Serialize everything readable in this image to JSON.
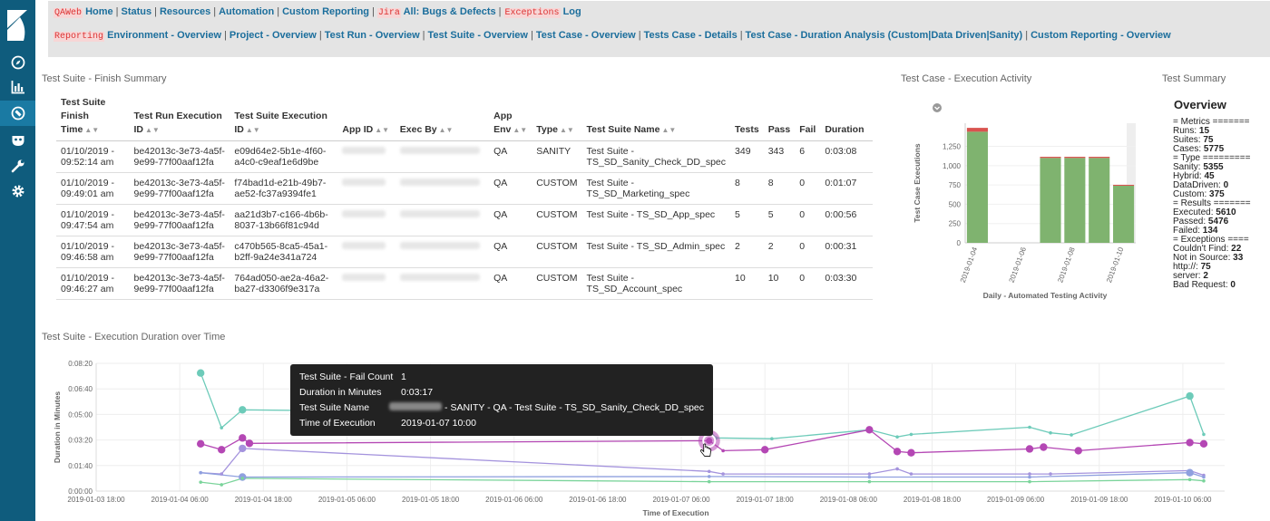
{
  "nav": {
    "row1": [
      {
        "tag": "QAWeb",
        "label": "Home"
      },
      {
        "tag": "",
        "label": "Status"
      },
      {
        "tag": "",
        "label": "Resources"
      },
      {
        "tag": "",
        "label": "Automation"
      },
      {
        "tag": "",
        "label": "Custom Reporting"
      },
      {
        "tag": "Jira",
        "label": "All: Bugs & Defects"
      },
      {
        "tag": "Exceptions",
        "label": "Log"
      }
    ],
    "row2": [
      {
        "tag": "Reporting",
        "label": "Environment - Overview"
      },
      {
        "tag": "",
        "label": "Project - Overview"
      },
      {
        "tag": "",
        "label": "Test Run - Overview"
      },
      {
        "tag": "",
        "label": "Test Suite - Overview"
      },
      {
        "tag": "",
        "label": "Test Case - Overview"
      },
      {
        "tag": "",
        "label": "Tests Case - Details"
      },
      {
        "tag": "",
        "label": "Test Case - Duration Analysis (Custom|Data Driven|Sanity)"
      },
      {
        "tag": "",
        "label": "Custom Reporting - Overview"
      }
    ]
  },
  "panels": {
    "finish_summary": "Test Suite - Finish Summary",
    "execution_activity": "Test Case - Execution Activity",
    "test_summary": "Test Summary",
    "duration_over_time": "Test Suite - Execution Duration over Time"
  },
  "table": {
    "headers": [
      "Test Suite Finish Time",
      "Test Run Execution ID",
      "Test Suite Execution ID",
      "App ID",
      "Exec By",
      "App Env",
      "Type",
      "Test Suite Name",
      "Tests",
      "Pass",
      "Fail",
      "Duration"
    ],
    "rows": [
      {
        "finish": "01/10/2019 - 09:52:14 am",
        "run_id": "be42013c-3e73-4a5f-9e99-77f00aaf12fa",
        "suite_id": "e09d64e2-5b1e-4f60-a4c0-c9eaf1e6d9be",
        "env": "QA",
        "type": "SANITY",
        "name": "Test Suite - TS_SD_Sanity_Check_DD_spec",
        "tests": "349",
        "pass": "343",
        "fail": "6",
        "duration": "0:03:08"
      },
      {
        "finish": "01/10/2019 - 09:49:01 am",
        "run_id": "be42013c-3e73-4a5f-9e99-77f00aaf12fa",
        "suite_id": "f74bad1d-e21b-49b7-ae52-fc37a9394fe1",
        "env": "QA",
        "type": "CUSTOM",
        "name": "Test Suite - TS_SD_Marketing_spec",
        "tests": "8",
        "pass": "8",
        "fail": "0",
        "duration": "0:01:07"
      },
      {
        "finish": "01/10/2019 - 09:47:54 am",
        "run_id": "be42013c-3e73-4a5f-9e99-77f00aaf12fa",
        "suite_id": "aa21d3b7-c166-4b6b-8037-13b66f81c94d",
        "env": "QA",
        "type": "CUSTOM",
        "name": "Test Suite - TS_SD_App_spec",
        "tests": "5",
        "pass": "5",
        "fail": "0",
        "duration": "0:00:56"
      },
      {
        "finish": "01/10/2019 - 09:46:58 am",
        "run_id": "be42013c-3e73-4a5f-9e99-77f00aaf12fa",
        "suite_id": "c470b565-8ca5-45a1-b2ff-9a24e341a724",
        "env": "QA",
        "type": "CUSTOM",
        "name": "Test Suite - TS_SD_Admin_spec",
        "tests": "2",
        "pass": "2",
        "fail": "0",
        "duration": "0:00:31"
      },
      {
        "finish": "01/10/2019 - 09:46:27 am",
        "run_id": "be42013c-3e73-4a5f-9e99-77f00aaf12fa",
        "suite_id": "764ad050-ae2a-46a2-ba27-d3306f9e317a",
        "env": "QA",
        "type": "CUSTOM",
        "name": "Test Suite - TS_SD_Account_spec",
        "tests": "10",
        "pass": "10",
        "fail": "0",
        "duration": "0:03:30"
      }
    ]
  },
  "summary": {
    "title": "Overview",
    "lines": [
      {
        "k": "= Metrics =======",
        "v": "",
        "head": true
      },
      {
        "k": "Runs: ",
        "v": "15"
      },
      {
        "k": "Suites: ",
        "v": "75"
      },
      {
        "k": "Cases: ",
        "v": "5775"
      },
      {
        "k": "= Type =========",
        "v": "",
        "head": true
      },
      {
        "k": "Sanity: ",
        "v": "5355"
      },
      {
        "k": "Hybrid: ",
        "v": "45"
      },
      {
        "k": "DataDriven: ",
        "v": "0"
      },
      {
        "k": "Custom: ",
        "v": "375"
      },
      {
        "k": "= Results =======",
        "v": "",
        "head": true
      },
      {
        "k": "Executed: ",
        "v": "5610"
      },
      {
        "k": "Passed: ",
        "v": "5476"
      },
      {
        "k": "Failed: ",
        "v": "134"
      },
      {
        "k": "= Exceptions ====",
        "v": "",
        "head": true
      },
      {
        "k": "Couldn't Find: ",
        "v": "22"
      },
      {
        "k": "Not in Source: ",
        "v": "33"
      },
      {
        "k": "http://: ",
        "v": "75"
      },
      {
        "k": "server: ",
        "v": "2"
      },
      {
        "k": "Bad Request: ",
        "v": "0"
      }
    ]
  },
  "tooltip": {
    "rows": [
      {
        "k": "Test Suite - Fail Count",
        "v": "1"
      },
      {
        "k": "Duration in Minutes",
        "v": "0:03:17"
      },
      {
        "k": "Test Suite Name",
        "v": " - SANITY - QA - Test Suite - TS_SD_Sanity_Check_DD_spec"
      },
      {
        "k": "Time of Execution",
        "v": "2019-01-07 10:00"
      }
    ]
  },
  "chart_data": [
    {
      "type": "bar",
      "xlabel": "Daily - Automated Testing Activity",
      "ylabel": "Test Case Executions",
      "categories": [
        "2019-01-04",
        "2019-01-05",
        "2019-01-06",
        "2019-01-07",
        "2019-01-08",
        "2019-01-09",
        "2019-01-10"
      ],
      "tick_labels": [
        "2019-01-04",
        "2019-01-06",
        "2019-01-08",
        "2019-01-10"
      ],
      "yticks": [
        0,
        250,
        500,
        750,
        1000,
        1250
      ],
      "ylim": [
        0,
        1550
      ],
      "series": [
        {
          "color": "#7fb36f",
          "values": [
            1440,
            0,
            0,
            1100,
            1100,
            1100,
            740
          ]
        },
        {
          "color": "#d9534f",
          "values": [
            50,
            0,
            0,
            15,
            15,
            15,
            12
          ]
        }
      ]
    },
    {
      "type": "line",
      "xlabel": "Time of Execution",
      "ylabel": "Duration in Minutes",
      "xlim": [
        "2019-01-03 18:00",
        "2019-01-10 12:00"
      ],
      "xticks": [
        "2019-01-03 18:00",
        "2019-01-04 06:00",
        "2019-01-04 18:00",
        "2019-01-05 06:00",
        "2019-01-05 18:00",
        "2019-01-06 06:00",
        "2019-01-06 18:00",
        "2019-01-07 06:00",
        "2019-01-07 18:00",
        "2019-01-08 06:00",
        "2019-01-08 18:00",
        "2019-01-09 06:00",
        "2019-01-09 18:00",
        "2019-01-10 06:00"
      ],
      "yticks": [
        "0:00:00",
        "0:01:40",
        "0:03:20",
        "0:05:00",
        "0:06:40",
        "0:08:20"
      ],
      "ylim": [
        0,
        500
      ],
      "series": [
        {
          "color": "#6dcbb9",
          "points": [
            [
              "2019-01-04 09:00",
              462
            ],
            [
              "2019-01-04 12:00",
              248
            ],
            [
              "2019-01-04 15:00",
              318
            ],
            [
              "2019-01-07 08:00",
              300
            ],
            [
              "2019-01-07 11:00",
              208
            ],
            [
              "2019-01-07 19:00",
              205
            ],
            [
              "2019-01-08 09:00",
              240
            ],
            [
              "2019-01-08 13:00",
              212
            ],
            [
              "2019-01-08 15:00",
              222
            ],
            [
              "2019-01-09 08:00",
              250
            ],
            [
              "2019-01-09 11:00",
              228
            ],
            [
              "2019-01-09 14:00",
              220
            ],
            [
              "2019-01-10 07:00",
              372
            ],
            [
              "2019-01-10 09:00",
              222
            ]
          ]
        },
        {
          "color": "#b447b4",
          "points": [
            [
              "2019-01-04 09:00",
              185
            ],
            [
              "2019-01-04 12:00",
              162
            ],
            [
              "2019-01-04 15:00",
              208
            ],
            [
              "2019-01-04 16:00",
              187
            ],
            [
              "2019-01-07 10:00",
              197
            ],
            [
              "2019-01-07 12:00",
              158
            ],
            [
              "2019-01-07 18:00",
              162
            ],
            [
              "2019-01-08 09:00",
              240
            ],
            [
              "2019-01-08 13:00",
              155
            ],
            [
              "2019-01-08 15:00",
              150
            ],
            [
              "2019-01-09 08:00",
              165
            ],
            [
              "2019-01-09 10:00",
              172
            ],
            [
              "2019-01-09 15:00",
              158
            ],
            [
              "2019-01-10 07:00",
              190
            ],
            [
              "2019-01-10 09:00",
              185
            ]
          ]
        },
        {
          "color": "#a493dd",
          "points": [
            [
              "2019-01-04 09:00",
              72
            ],
            [
              "2019-01-04 12:00",
              67
            ],
            [
              "2019-01-04 15:00",
              167
            ],
            [
              "2019-01-07 10:00",
              77
            ],
            [
              "2019-01-07 12:00",
              67
            ],
            [
              "2019-01-08 09:00",
              67
            ],
            [
              "2019-01-08 13:00",
              87
            ],
            [
              "2019-01-08 15:00",
              67
            ],
            [
              "2019-01-09 08:00",
              67
            ],
            [
              "2019-01-09 11:00",
              67
            ],
            [
              "2019-01-10 07:00",
              80
            ],
            [
              "2019-01-10 09:00",
              62
            ]
          ]
        },
        {
          "color": "#8fa0df",
          "points": [
            [
              "2019-01-04 09:00",
              72
            ],
            [
              "2019-01-04 15:00",
              55
            ],
            [
              "2019-01-07 10:00",
              57
            ],
            [
              "2019-01-08 09:00",
              55
            ],
            [
              "2019-01-09 08:00",
              55
            ],
            [
              "2019-01-10 07:00",
              72
            ],
            [
              "2019-01-10 09:00",
              55
            ]
          ]
        },
        {
          "color": "#7bd49b",
          "points": [
            [
              "2019-01-04 09:00",
              35
            ],
            [
              "2019-01-04 12:00",
              25
            ],
            [
              "2019-01-04 15:00",
              50
            ],
            [
              "2019-01-07 10:00",
              37
            ],
            [
              "2019-01-08 09:00",
              37
            ],
            [
              "2019-01-09 08:00",
              37
            ],
            [
              "2019-01-10 07:00",
              45
            ],
            [
              "2019-01-10 09:00",
              40
            ]
          ]
        }
      ]
    }
  ]
}
